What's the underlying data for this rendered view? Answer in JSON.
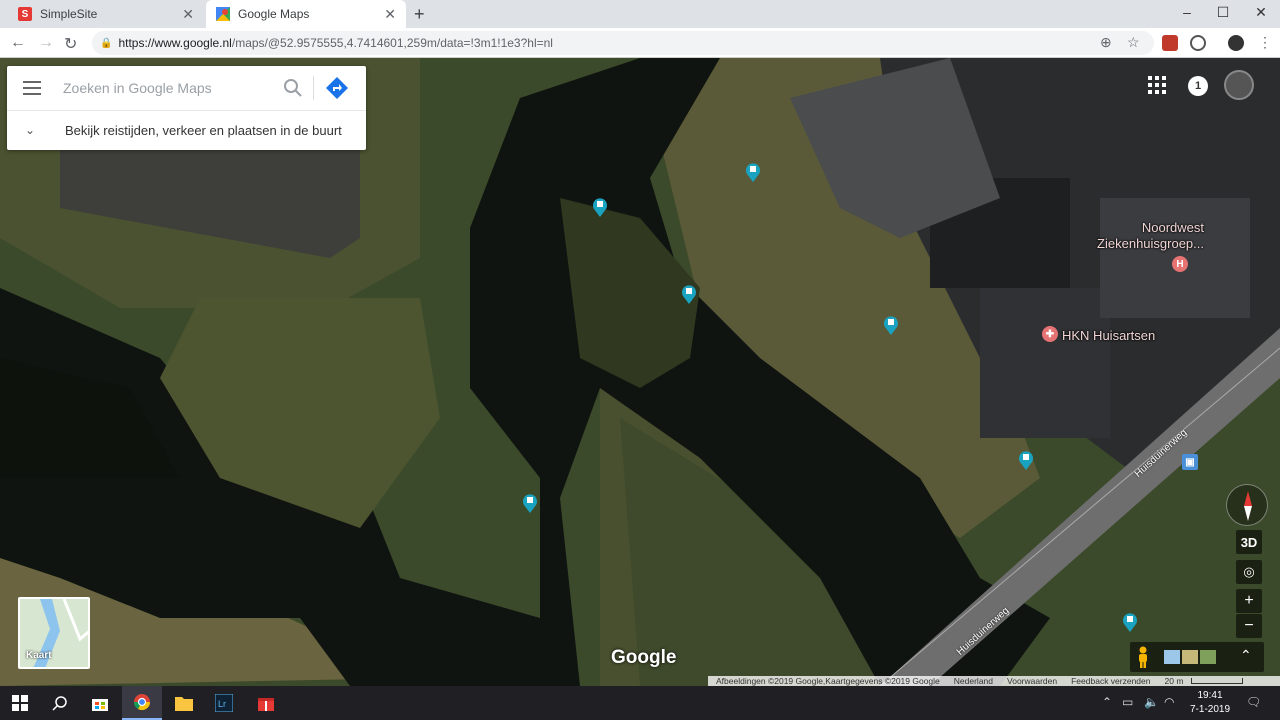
{
  "browser": {
    "tabs": [
      {
        "title": "SimpleSite",
        "favicon": "S",
        "active": false
      },
      {
        "title": "Google Maps",
        "favicon": "maps-icon",
        "active": true
      }
    ],
    "new_tab": "+",
    "window_controls": {
      "minimize": "–",
      "maximize": "☐",
      "close": "✕"
    },
    "url_host": "https://www.google.nl",
    "url_path": "/maps/@52.9575555,4.7414601,259m/data=!3m1!1e3?hl=nl"
  },
  "maps": {
    "search_placeholder": "Zoeken in Google Maps",
    "nearby_text": "Bekijk reistijden, verkeer en plaatsen in de buurt",
    "notifications_count": "1",
    "places": [
      {
        "name": "Noordwest\nZiekenhuisgroep...",
        "type": "hospital"
      },
      {
        "name": "HKN Huisartsen",
        "type": "medical"
      }
    ],
    "streets": [
      "Huisduinerweg",
      "Huisduinerweg"
    ],
    "controls": {
      "tilt": "3D",
      "zoom_in": "+",
      "zoom_out": "−",
      "expand": "⌃"
    },
    "layer_switch_label": "Kaart",
    "logo": "Google",
    "footer": {
      "attribution": "Afbeeldingen ©2019 Google,Kaartgegevens ©2019 Google",
      "country": "Nederland",
      "terms": "Voorwaarden",
      "feedback": "Feedback verzenden",
      "scale": "20 m"
    }
  },
  "taskbar": {
    "apps": [
      "start",
      "search",
      "store",
      "chrome",
      "explorer",
      "lightroom",
      "gift"
    ],
    "time": "19:41",
    "date": "7-1-2019"
  }
}
